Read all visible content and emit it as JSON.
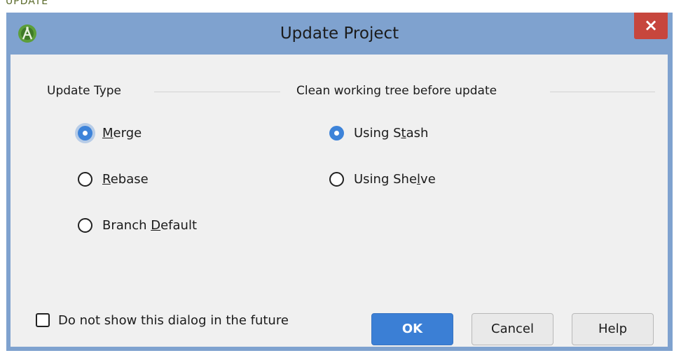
{
  "background": {
    "text": "UPDATE"
  },
  "window": {
    "title": "Update Project",
    "close_glyph": "×",
    "app_icon": "android-studio-icon"
  },
  "update_type": {
    "label": "Update Type",
    "options": [
      {
        "label": "Merge",
        "mnemonic": "M",
        "selected": true
      },
      {
        "label": "Rebase",
        "mnemonic": "R",
        "selected": false
      },
      {
        "label": "Branch Default",
        "mnemonic": "D",
        "selected": false
      }
    ]
  },
  "clean_tree": {
    "label": "Clean working tree before update",
    "options": [
      {
        "label": "Using Stash",
        "mnemonic": "t",
        "selected": true
      },
      {
        "label": "Using Shelve",
        "mnemonic": "l",
        "selected": false
      }
    ]
  },
  "dont_show": {
    "label": "Do not show this dialog in the future",
    "checked": false
  },
  "buttons": {
    "ok": "OK",
    "cancel": "Cancel",
    "help": "Help"
  },
  "colors": {
    "title_bar": "#7fa2cf",
    "close_button": "#c7463d",
    "accent": "#3b7fd5",
    "dialog_bg": "#f0f0f0"
  }
}
